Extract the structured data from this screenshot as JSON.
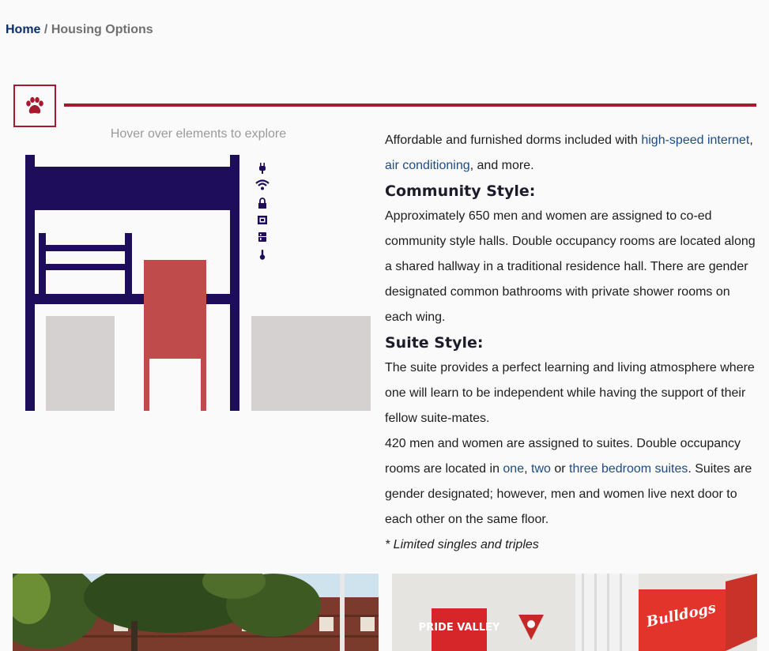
{
  "breadcrumb": {
    "home": "Home",
    "separator": "/",
    "current": "Housing Options"
  },
  "section": {
    "icon": "paw-icon",
    "accent": "#a6192e"
  },
  "illustration": {
    "hint": "Hover over elements to explore",
    "amenity_icons": [
      "plug-icon",
      "wifi-icon",
      "lock-icon",
      "microwave-icon",
      "fridge-icon",
      "thermometer-icon"
    ],
    "colors": {
      "frame": "#1d0d5a",
      "chair": "#c04b4b",
      "furniture": "#d6d1d1"
    }
  },
  "content": {
    "intro_before": "Affordable and furnished dorms included with ",
    "link_internet": "high-speed internet",
    "intro_comma": ", ",
    "link_ac": "air conditioning",
    "intro_after": ", and more.",
    "community_heading": "Community Style:",
    "community_text": "Approximately 650 men and women are assigned to co-ed community style halls. Double occupancy rooms are located along a shared hallway in a traditional residence hall. There are gender designated common bathrooms with private shower rooms on each wing.",
    "suite_heading": "Suite Style:",
    "suite_text1": "The suite provides a perfect learning and living atmosphere where one will learn to be independent while having the support of their fellow suite-mates.",
    "suite_text2_before": "420 men and women are assigned to suites. Double occupancy rooms are located in ",
    "link_one": "one",
    "comma": ", ",
    "link_two": "two",
    "or": " or ",
    "link_three": "three bedroom suites",
    "suite_text2_after": ". Suites are gender designated; however, men and women live next door to each other on the same floor.",
    "note": "* Limited singles and triples"
  },
  "photos": {
    "left": {
      "banner_text": ""
    },
    "right": {
      "banner_left": "PRIDE VALLEY",
      "banner_right": "Bulldogs"
    }
  }
}
